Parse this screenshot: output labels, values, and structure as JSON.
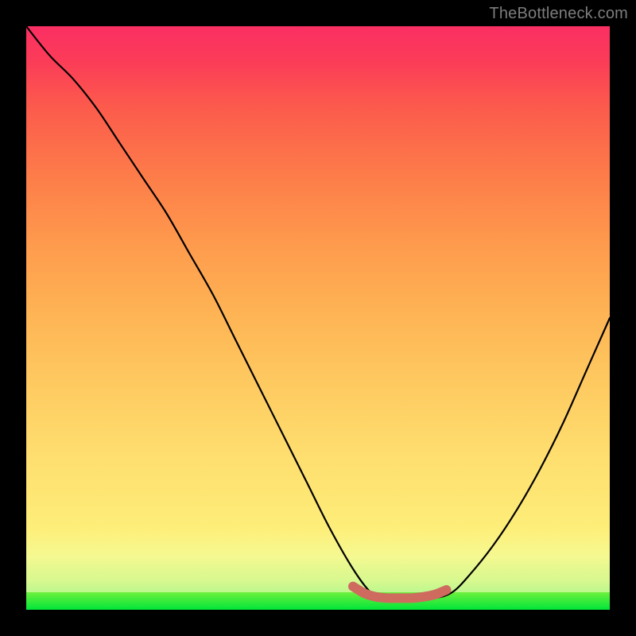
{
  "watermark": "TheBottleneck.com",
  "colors": {
    "stroke_curve": "#000000",
    "bottleneck_stroke": "#cf6a5f",
    "background": "#000000"
  },
  "chart_data": {
    "type": "line",
    "title": "",
    "xlabel": "",
    "ylabel": "",
    "xlim": [
      0,
      100
    ],
    "ylim": [
      0,
      100
    ],
    "series": [
      {
        "name": "curve",
        "x": [
          0,
          4,
          8,
          12,
          16,
          20,
          24,
          28,
          32,
          36,
          40,
          44,
          48,
          52,
          56,
          59,
          61,
          64,
          67,
          70,
          73,
          76,
          80,
          84,
          88,
          92,
          96,
          100
        ],
        "values": [
          100,
          95,
          91,
          86,
          80,
          74,
          68,
          61,
          54,
          46,
          38,
          30,
          22,
          14,
          7,
          3,
          2,
          2,
          2,
          2,
          3,
          6,
          11,
          17,
          24,
          32,
          41,
          50
        ]
      }
    ],
    "bottleneck_segment": {
      "x": [
        56,
        58,
        60,
        62,
        64,
        66,
        68,
        70,
        72
      ],
      "values": [
        4.0,
        2.8,
        2.2,
        2.0,
        2.0,
        2.0,
        2.2,
        2.6,
        3.4
      ]
    },
    "gradient_semantics": "green(bottom)=good / red(top)=bad"
  }
}
